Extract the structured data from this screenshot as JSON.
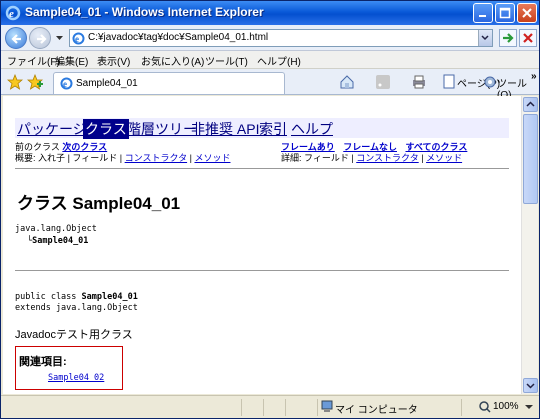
{
  "window": {
    "title": "Sample04_01 - Windows Internet Explorer"
  },
  "address_bar": {
    "url": "C:¥javadoc¥tag¥doc¥Sample04_01.html"
  },
  "menu": [
    "ファイル(F)",
    "編集(E)",
    "表示(V)",
    "お気に入り(A)",
    "ツール(T)",
    "ヘルプ(H)"
  ],
  "tab": {
    "label": "Sample04_01"
  },
  "command_bar": {
    "page_label": "ページ(P)",
    "tools_label": "ツール(O)",
    "chevron": "»"
  },
  "doc_nav": {
    "items": [
      "パッケージ",
      "クラス",
      "階層ツリー",
      "非推奨 API",
      "索引",
      "ヘルプ"
    ],
    "prev_class": "前のクラス",
    "next_class": "次のクラス",
    "frames": "フレームあり",
    "no_frames": "フレームなし",
    "all_classes": "すべてのクラス",
    "summary_label": "概要:",
    "summary_nested": "入れ子",
    "summary_field": "フィールド",
    "summary_constructor": "コンストラクタ",
    "summary_method": "メソッド",
    "detail_label": "詳細:",
    "detail_field": "フィールド",
    "detail_constructor": "コンストラクタ",
    "detail_method": "メソッド",
    "separator": "|"
  },
  "class_doc": {
    "heading": "クラス Sample04_01",
    "hierarchy_parent": "java.lang.Object",
    "hierarchy_child": "Sample04_01",
    "hierarchy_connector": "└",
    "declaration_prefix": "public class ",
    "declaration_name": "Sample04_01",
    "extends_line": "extends java.lang.Object",
    "description": "Javadocテスト用クラス",
    "see_also_label": "関連項目:",
    "see_also_link": "Sample04_02"
  },
  "status_bar": {
    "zone": "マイ コンピュータ",
    "zoom": "100%"
  }
}
